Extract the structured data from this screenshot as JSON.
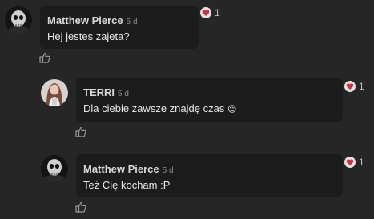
{
  "comments": [
    {
      "author": "Matthew Pierce",
      "time": "5 d",
      "text": "Hej jestes zajeta?",
      "reaction_count": "1",
      "avatar": "skull-avatar"
    },
    {
      "author": "TERRI",
      "time": "5 d",
      "text": "Dla ciebie zawsze znajdę czas",
      "emoji": "😌",
      "reaction_count": "1",
      "avatar": "woman-photo-avatar"
    },
    {
      "author": "Matthew Pierce",
      "time": "5 d",
      "text": "Też Cię kocham :P",
      "reaction_count": "1",
      "avatar": "skull-avatar"
    }
  ],
  "icons": {
    "reaction": "heart-reaction-icon",
    "like": "thumbs-up-icon"
  },
  "colors": {
    "background": "#262626",
    "bubble": "#1c1c1c",
    "heart": "#d42f3a",
    "text": "#e8e8e8"
  }
}
